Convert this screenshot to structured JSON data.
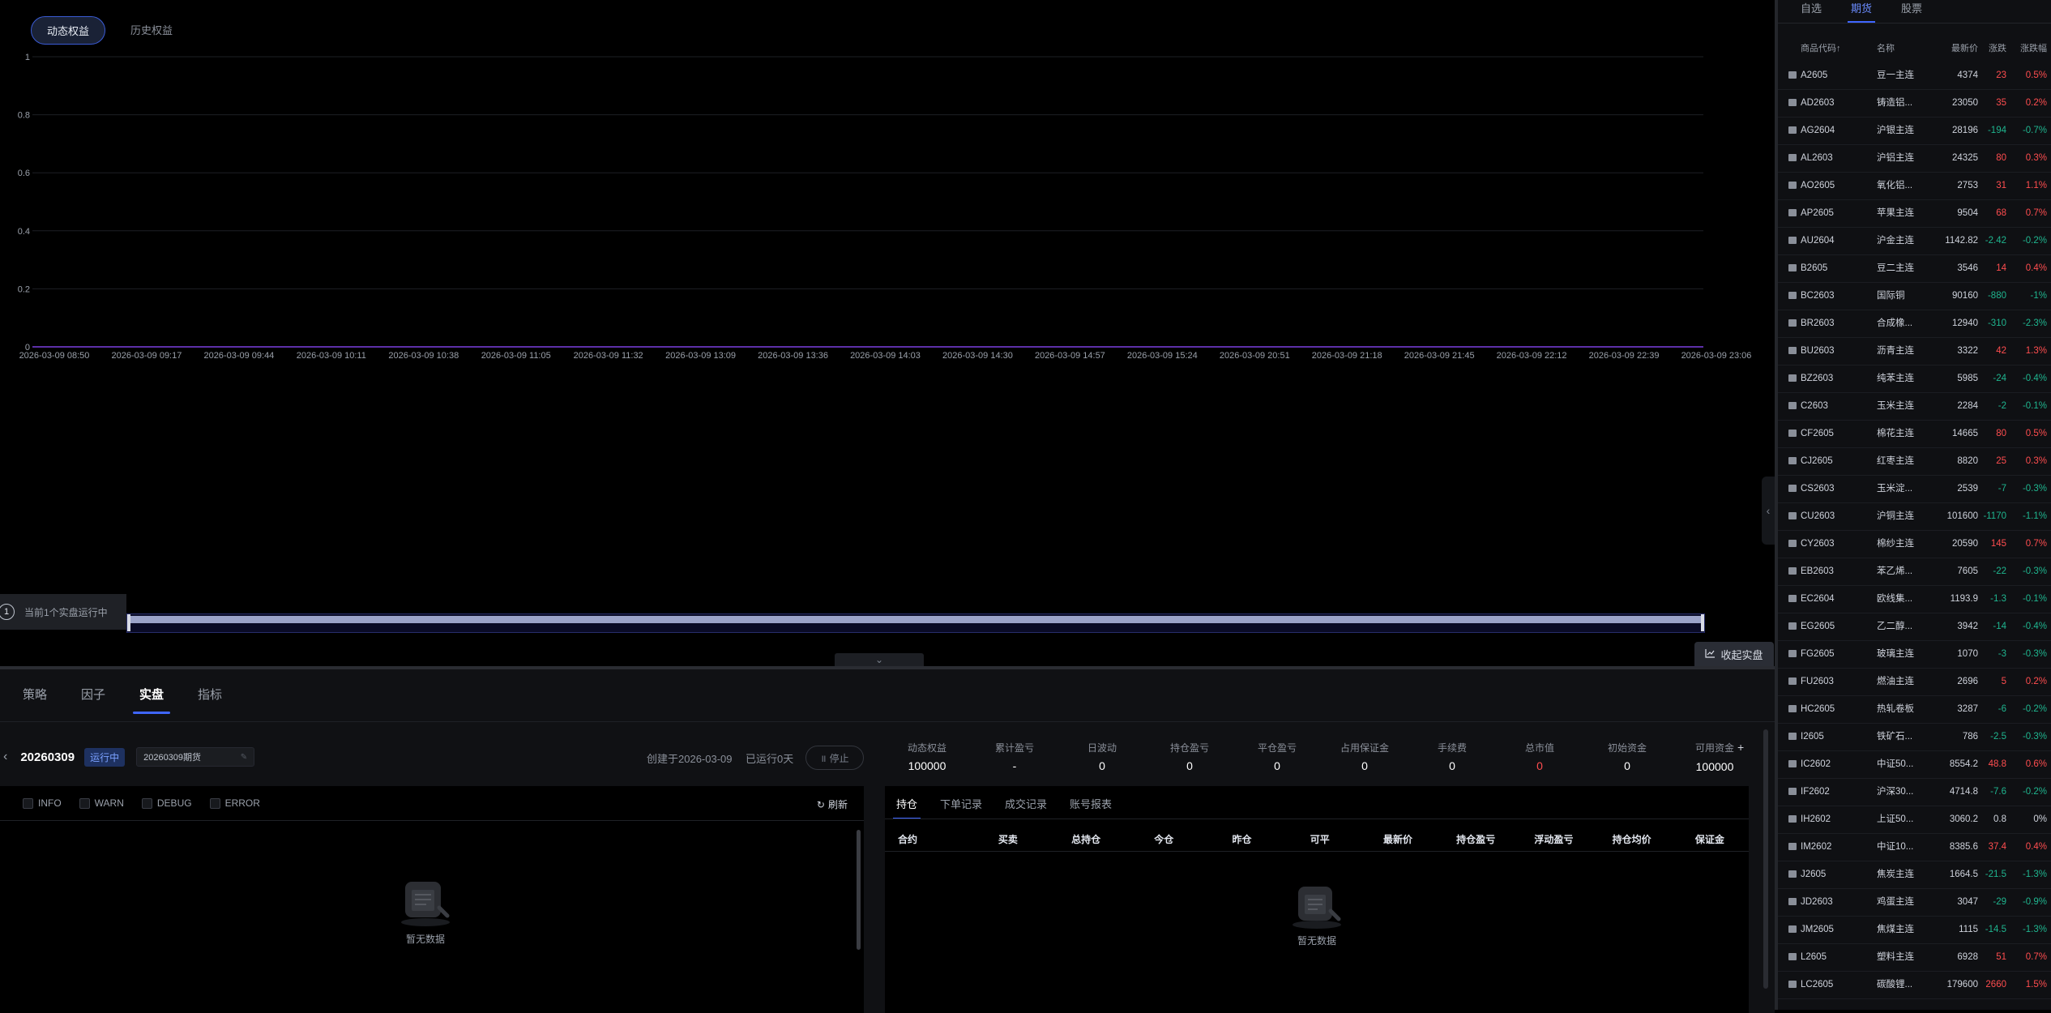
{
  "chart_tabs": [
    "动态权益",
    "历史权益"
  ],
  "chart_data": {
    "type": "line",
    "ylim": [
      0,
      1
    ],
    "y_ticks": [
      "1",
      "0.8",
      "0.6",
      "0.4",
      "0.2",
      "0"
    ],
    "x_ticks": [
      "2026-03-09 08:50",
      "2026-03-09 09:17",
      "2026-03-09 09:44",
      "2026-03-09 10:11",
      "2026-03-09 10:38",
      "2026-03-09 11:05",
      "2026-03-09 11:32",
      "2026-03-09 13:09",
      "2026-03-09 13:36",
      "2026-03-09 14:03",
      "2026-03-09 14:30",
      "2026-03-09 14:57",
      "2026-03-09 15:24",
      "2026-03-09 20:51",
      "2026-03-09 21:18",
      "2026-03-09 21:45",
      "2026-03-09 22:12",
      "2026-03-09 22:39",
      "2026-03-09 23:06"
    ],
    "series": [
      {
        "values": [
          0,
          0
        ]
      }
    ],
    "grid": true
  },
  "running": {
    "count": "1",
    "text": "当前1个实盘运行中"
  },
  "collect_label": "收起实盘",
  "main_tabs": [
    "策略",
    "因子",
    "实盘",
    "指标"
  ],
  "strategy": {
    "id": "20260309",
    "status": "运行中",
    "name": "20260309期货",
    "created": "创建于2026-03-09",
    "ran": "已运行0天",
    "stop": "停止"
  },
  "metrics": [
    {
      "label": "动态权益",
      "value": "100000",
      "color": "#ffffff"
    },
    {
      "label": "累计盈亏",
      "value": "-",
      "color": "#ffffff"
    },
    {
      "label": "日波动",
      "value": "0",
      "color": "#ffffff"
    },
    {
      "label": "持仓盈亏",
      "value": "0",
      "color": "#ffffff"
    },
    {
      "label": "平仓盈亏",
      "value": "0",
      "color": "#ffffff"
    },
    {
      "label": "占用保证金",
      "value": "0",
      "color": "#ffffff"
    },
    {
      "label": "手续费",
      "value": "0",
      "color": "#ffffff"
    },
    {
      "label": "总市值",
      "value": "0",
      "color": "#ff4d4f"
    },
    {
      "label": "初始资金",
      "value": "0",
      "color": "#ffffff"
    },
    {
      "label": "可用资金",
      "value": "100000",
      "color": "#ffffff"
    }
  ],
  "log": {
    "levels": [
      "INFO",
      "WARN",
      "DEBUG",
      "ERROR"
    ],
    "refresh": "刷新",
    "empty": "暂无数据"
  },
  "positions": {
    "tabs": [
      "持仓",
      "下单记录",
      "成交记录",
      "账号报表"
    ],
    "columns": [
      "合约",
      "买卖",
      "总持仓",
      "今仓",
      "昨仓",
      "可平",
      "最新价",
      "持仓盈亏",
      "浮动盈亏",
      "持仓均价",
      "保证金"
    ],
    "empty": "暂无数据"
  },
  "quotes": {
    "tabs": [
      "自选",
      "期货",
      "股票"
    ],
    "headers": {
      "code": "商品代码↑",
      "name": "名称",
      "price": "最新价",
      "chg": "涨跌",
      "pct": "涨跌幅"
    },
    "rows": [
      {
        "code": "A2605",
        "name": "豆一主连",
        "price": "4374",
        "chg": "23",
        "pct": "0.5%",
        "dir": "up"
      },
      {
        "code": "AD2603",
        "name": "铸造铝...",
        "price": "23050",
        "chg": "35",
        "pct": "0.2%",
        "dir": "up"
      },
      {
        "code": "AG2604",
        "name": "沪银主连",
        "price": "28196",
        "chg": "-194",
        "pct": "-0.7%",
        "dir": "down"
      },
      {
        "code": "AL2603",
        "name": "沪铝主连",
        "price": "24325",
        "chg": "80",
        "pct": "0.3%",
        "dir": "up"
      },
      {
        "code": "AO2605",
        "name": "氧化铝...",
        "price": "2753",
        "chg": "31",
        "pct": "1.1%",
        "dir": "up"
      },
      {
        "code": "AP2605",
        "name": "苹果主连",
        "price": "9504",
        "chg": "68",
        "pct": "0.7%",
        "dir": "up"
      },
      {
        "code": "AU2604",
        "name": "沪金主连",
        "price": "1142.82",
        "chg": "-2.42",
        "pct": "-0.2%",
        "dir": "down"
      },
      {
        "code": "B2605",
        "name": "豆二主连",
        "price": "3546",
        "chg": "14",
        "pct": "0.4%",
        "dir": "up"
      },
      {
        "code": "BC2603",
        "name": "国际铜",
        "price": "90160",
        "chg": "-880",
        "pct": "-1%",
        "dir": "down"
      },
      {
        "code": "BR2603",
        "name": "合成橡...",
        "price": "12940",
        "chg": "-310",
        "pct": "-2.3%",
        "dir": "down"
      },
      {
        "code": "BU2603",
        "name": "沥青主连",
        "price": "3322",
        "chg": "42",
        "pct": "1.3%",
        "dir": "up"
      },
      {
        "code": "BZ2603",
        "name": "纯苯主连",
        "price": "5985",
        "chg": "-24",
        "pct": "-0.4%",
        "dir": "down"
      },
      {
        "code": "C2603",
        "name": "玉米主连",
        "price": "2284",
        "chg": "-2",
        "pct": "-0.1%",
        "dir": "down"
      },
      {
        "code": "CF2605",
        "name": "棉花主连",
        "price": "14665",
        "chg": "80",
        "pct": "0.5%",
        "dir": "up"
      },
      {
        "code": "CJ2605",
        "name": "红枣主连",
        "price": "8820",
        "chg": "25",
        "pct": "0.3%",
        "dir": "up"
      },
      {
        "code": "CS2603",
        "name": "玉米淀...",
        "price": "2539",
        "chg": "-7",
        "pct": "-0.3%",
        "dir": "down"
      },
      {
        "code": "CU2603",
        "name": "沪铜主连",
        "price": "101600",
        "chg": "-1170",
        "pct": "-1.1%",
        "dir": "down"
      },
      {
        "code": "CY2603",
        "name": "棉纱主连",
        "price": "20590",
        "chg": "145",
        "pct": "0.7%",
        "dir": "up"
      },
      {
        "code": "EB2603",
        "name": "苯乙烯...",
        "price": "7605",
        "chg": "-22",
        "pct": "-0.3%",
        "dir": "down"
      },
      {
        "code": "EC2604",
        "name": "欧线集...",
        "price": "1193.9",
        "chg": "-1.3",
        "pct": "-0.1%",
        "dir": "down"
      },
      {
        "code": "EG2605",
        "name": "乙二醇...",
        "price": "3942",
        "chg": "-14",
        "pct": "-0.4%",
        "dir": "down"
      },
      {
        "code": "FG2605",
        "name": "玻璃主连",
        "price": "1070",
        "chg": "-3",
        "pct": "-0.3%",
        "dir": "down"
      },
      {
        "code": "FU2603",
        "name": "燃油主连",
        "price": "2696",
        "chg": "5",
        "pct": "0.2%",
        "dir": "up"
      },
      {
        "code": "HC2605",
        "name": "热轧卷板",
        "price": "3287",
        "chg": "-6",
        "pct": "-0.2%",
        "dir": "down"
      },
      {
        "code": "I2605",
        "name": "铁矿石...",
        "price": "786",
        "chg": "-2.5",
        "pct": "-0.3%",
        "dir": "down"
      },
      {
        "code": "IC2602",
        "name": "中证50...",
        "price": "8554.2",
        "chg": "48.8",
        "pct": "0.6%",
        "dir": "up"
      },
      {
        "code": "IF2602",
        "name": "沪深30...",
        "price": "4714.8",
        "chg": "-7.6",
        "pct": "-0.2%",
        "dir": "down"
      },
      {
        "code": "IH2602",
        "name": "上证50...",
        "price": "3060.2",
        "chg": "0.8",
        "pct": "0%",
        "dir": "flat"
      },
      {
        "code": "IM2602",
        "name": "中证10...",
        "price": "8385.6",
        "chg": "37.4",
        "pct": "0.4%",
        "dir": "up"
      },
      {
        "code": "J2605",
        "name": "焦炭主连",
        "price": "1664.5",
        "chg": "-21.5",
        "pct": "-1.3%",
        "dir": "down"
      },
      {
        "code": "JD2603",
        "name": "鸡蛋主连",
        "price": "3047",
        "chg": "-29",
        "pct": "-0.9%",
        "dir": "down"
      },
      {
        "code": "JM2605",
        "name": "焦煤主连",
        "price": "1115",
        "chg": "-14.5",
        "pct": "-1.3%",
        "dir": "down"
      },
      {
        "code": "L2605",
        "name": "塑料主连",
        "price": "6928",
        "chg": "51",
        "pct": "0.7%",
        "dir": "up"
      },
      {
        "code": "LC2605",
        "name": "碳酸锂...",
        "price": "179600",
        "chg": "2660",
        "pct": "1.5%",
        "dir": "up"
      }
    ]
  }
}
